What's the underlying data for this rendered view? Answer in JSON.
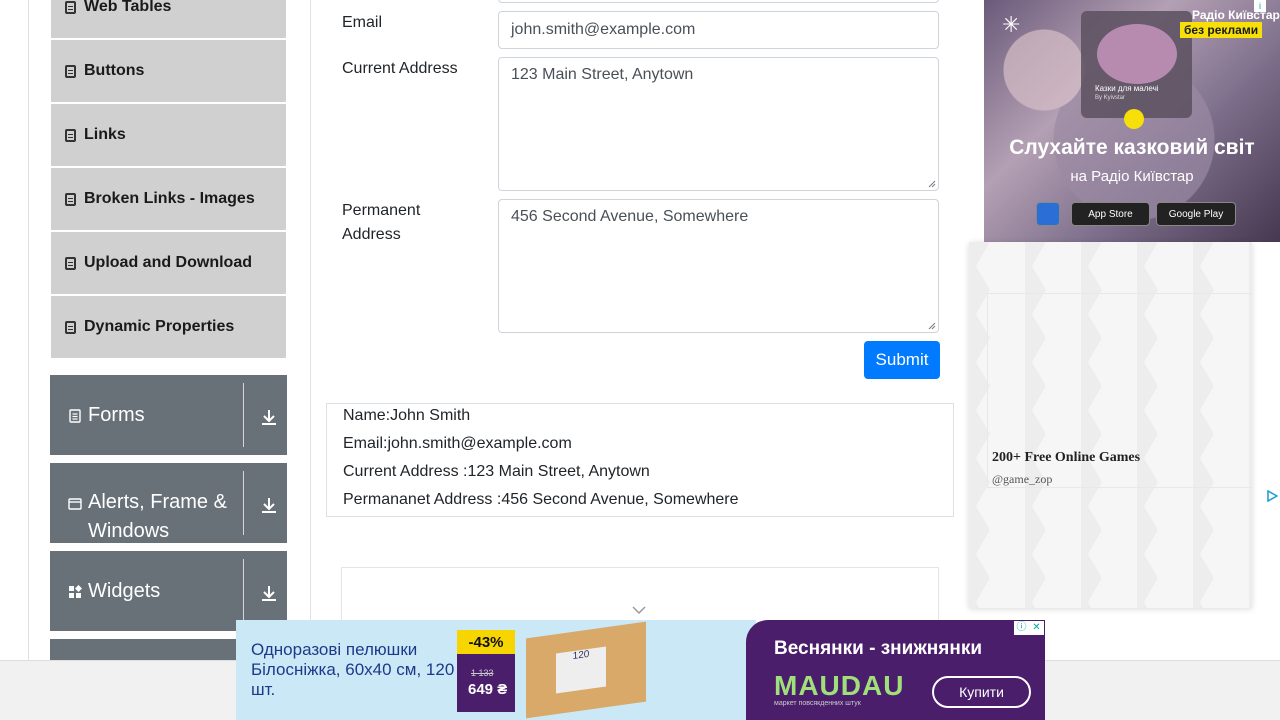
{
  "sidebar": {
    "sub_items": [
      {
        "label": "Web Tables"
      },
      {
        "label": "Buttons"
      },
      {
        "label": "Links"
      },
      {
        "label": "Broken Links - Images"
      },
      {
        "label": "Upload and Download"
      },
      {
        "label": "Dynamic Properties"
      }
    ],
    "groups": [
      {
        "label": "Forms"
      },
      {
        "label": "Alerts, Frame & Windows"
      },
      {
        "label": "Widgets"
      }
    ]
  },
  "form": {
    "email_label": "Email",
    "email_value": "john.smith@example.com",
    "current_label": "Current Address",
    "current_value": "123 Main Street, Anytown",
    "permanent_label": "Permanent Address",
    "permanent_value": "456 Second Avenue, Somewhere",
    "submit_label": "Submit"
  },
  "output": {
    "name": "Name:John Smith",
    "email": "Email:john.smith@example.com",
    "current": "Current Address :123 Main Street, Anytown",
    "permanent": "Permananet Address :456 Second Avenue, Somewhere"
  },
  "ad_right": {
    "brand_top": "Радіо Київстар",
    "brand_badge": "без реклами",
    "card_title": "Казки для малечі",
    "card_sub": "By Kyivstar",
    "headline": "Слухайте казковий світ",
    "subline": "на Радіо Київстар",
    "app_store": "App Store",
    "google_play": "Google Play"
  },
  "ad_games": {
    "title": "200+ Free Online Games",
    "handle": "@game_zop"
  },
  "ad_bottom": {
    "product": "Одноразові пелюшки Білосніжка, 60х40 см, 120 шт.",
    "discount": "-43%",
    "old_price": "1 133",
    "new_price": "649 ₴",
    "box_label": "120",
    "headline": "Веснянки - знижнянки",
    "logo": "MAUDAU",
    "tagline": "маркет повсякденних штук",
    "buy": "Купити"
  },
  "colors": {
    "submit": "#007bff",
    "sidebar_group": "#687078",
    "sidebar_item": "#d0d0d0",
    "ad_purple": "#4a1e6b",
    "ad_yellow": "#f7d500"
  }
}
